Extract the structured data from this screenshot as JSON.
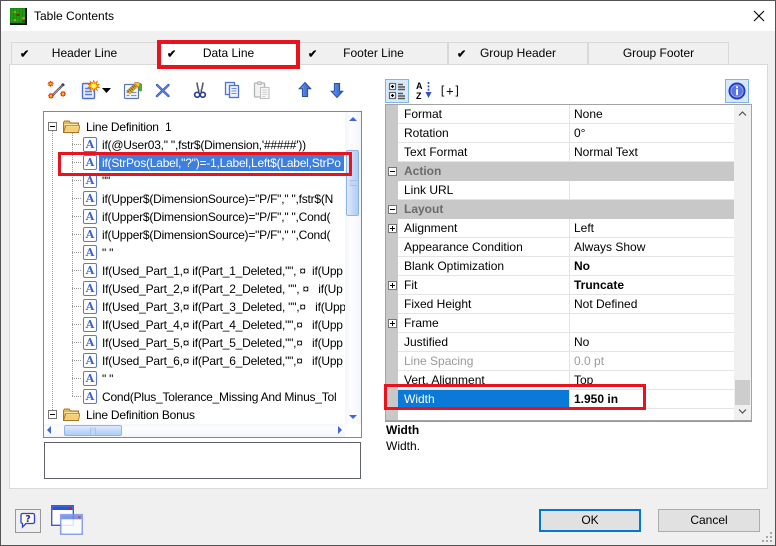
{
  "window": {
    "title": "Table Contents",
    "icon": "table-green-icon",
    "close": "close"
  },
  "tabs": [
    {
      "label": "Header Line",
      "checked": true,
      "selected": false
    },
    {
      "label": "Data Line",
      "checked": true,
      "selected": true,
      "annotated": true
    },
    {
      "label": "Footer Line",
      "checked": true,
      "selected": false
    },
    {
      "label": "Group Header",
      "checked": true,
      "selected": false
    },
    {
      "label": "Group Footer",
      "checked": false,
      "selected": false
    }
  ],
  "toolbar": {
    "buttons": [
      {
        "icon": "insert-wizard-wand-icon"
      },
      {
        "icon": "new-line-definition-icon",
        "has_dropdown": true
      },
      {
        "icon": "edit-properties-icon"
      },
      {
        "icon": "delete-icon"
      },
      {
        "icon": "cut-icon"
      },
      {
        "icon": "copy-icon"
      },
      {
        "icon": "paste-icon",
        "disabled": true
      },
      {
        "icon": "move-up-icon"
      },
      {
        "icon": "move-down-icon"
      }
    ]
  },
  "tree": {
    "items": [
      {
        "type": "folder",
        "label": "Line Definition  1",
        "expanded": true
      },
      {
        "type": "field",
        "label": "if(@User03,\" \",fstr$(Dimension,'#####'))"
      },
      {
        "type": "field",
        "label": "if(StrPos(Label,\"?\")=-1,Label,Left$(Label,StrPo",
        "selected": true,
        "annotated": true
      },
      {
        "type": "field",
        "label": "\"\""
      },
      {
        "type": "field",
        "label": "if(Upper$(DimensionSource)=\"P/F\",\" \",fstr$(N"
      },
      {
        "type": "field",
        "label": "if(Upper$(DimensionSource)=\"P/F\",\" \",Cond("
      },
      {
        "type": "field",
        "label": "if(Upper$(DimensionSource)=\"P/F\",\" \",Cond("
      },
      {
        "type": "field",
        "label": "\" \""
      },
      {
        "type": "field",
        "label": "If(Used_Part_1,¤ if(Part_1_Deleted,\"\", ¤  if(Upp"
      },
      {
        "type": "field",
        "label": "If(Used_Part_2,¤ if(Part_2_Deleted, \"\", ¤   if(Up"
      },
      {
        "type": "field",
        "label": "If(Used_Part_3,¤ if(Part_3_Deleted, \"\",¤   if(Upp"
      },
      {
        "type": "field",
        "label": "If(Used_Part_4,¤ if(Part_4_Deleted,\"\",¤   if(Upp"
      },
      {
        "type": "field",
        "label": "If(Used_Part_5,¤ if(Part_5_Deleted,\"\",¤   if(Upp"
      },
      {
        "type": "field",
        "label": "If(Used_Part_6,¤ if(Part_6_Deleted,\"\",¤   if(Upp"
      },
      {
        "type": "field",
        "label": "\" \""
      },
      {
        "type": "field",
        "label": "Cond(Plus_Tolerance_Missing And Minus_Tol"
      },
      {
        "type": "folder",
        "label": "Line Definition Bonus",
        "expanded": true
      }
    ]
  },
  "property_toolbar": {
    "buttons": [
      {
        "icon": "categorized-view-icon",
        "pressed": true
      },
      {
        "icon": "sort-az-icon"
      },
      {
        "icon": "expand-all-icon",
        "glyph": "[+]"
      },
      {
        "icon": "info-icon",
        "pressed": true
      }
    ]
  },
  "property_grid": {
    "rows": [
      {
        "kind": "prop",
        "name": "Format",
        "value": "None"
      },
      {
        "kind": "prop",
        "name": "Rotation",
        "value": "0°"
      },
      {
        "kind": "prop",
        "name": "Text Format",
        "value": "Normal Text"
      },
      {
        "kind": "category",
        "name": "Action"
      },
      {
        "kind": "prop",
        "name": "Link URL",
        "value": ""
      },
      {
        "kind": "category",
        "name": "Layout"
      },
      {
        "kind": "prop",
        "name": "Alignment",
        "value": "Left",
        "expandable": true
      },
      {
        "kind": "prop",
        "name": "Appearance Condition",
        "value": "Always Show"
      },
      {
        "kind": "prop",
        "name": "Blank Optimization",
        "value": "No",
        "bold": true
      },
      {
        "kind": "prop",
        "name": "Fit",
        "value": "Truncate",
        "bold": true,
        "expandable": true
      },
      {
        "kind": "prop",
        "name": "Fixed Height",
        "value": "Not Defined"
      },
      {
        "kind": "prop",
        "name": "Frame",
        "value": "",
        "expandable": true
      },
      {
        "kind": "prop",
        "name": "Justified",
        "value": "No"
      },
      {
        "kind": "prop",
        "name": "Line Spacing",
        "value": "0.0 pt",
        "disabled": true
      },
      {
        "kind": "prop",
        "name": "Vert. Alignment",
        "value": "Top"
      },
      {
        "kind": "prop",
        "name": "Width",
        "value": "1.950 in",
        "bold": true,
        "selected": true,
        "annotated": true
      }
    ],
    "description_title": "Width",
    "description_text": "Width."
  },
  "buttons": {
    "ok": "OK",
    "cancel": "Cancel",
    "help_icon": "help-icon",
    "preview_icon": "preview-windows-icon"
  }
}
